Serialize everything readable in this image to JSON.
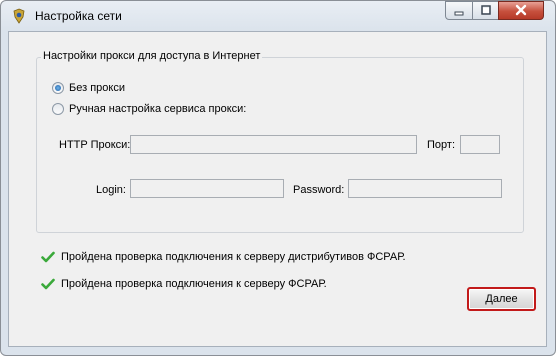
{
  "window": {
    "title": "Настройка сети"
  },
  "proxy_group": {
    "legend": "Настройки прокси для доступа в Интернет",
    "options": [
      {
        "label": "Без прокси",
        "checked": true
      },
      {
        "label": "Ручная настройка сервиса прокси:",
        "checked": false
      }
    ],
    "http_proxy_label": "HTTP Прокси:",
    "http_proxy_value": "",
    "port_label": "Порт:",
    "port_value": "",
    "login_label": "Login:",
    "login_value": "",
    "password_label": "Password:",
    "password_value": ""
  },
  "checks": [
    {
      "text": "Пройдена проверка подключения к серверу дистрибутивов ФСРАР.",
      "status_icon": "check-icon",
      "color": "#3aa93a"
    },
    {
      "text": "Пройдена проверка подключения к серверу ФСРАР.",
      "status_icon": "check-icon",
      "color": "#3aa93a"
    }
  ],
  "buttons": {
    "next_label": "Далее"
  }
}
